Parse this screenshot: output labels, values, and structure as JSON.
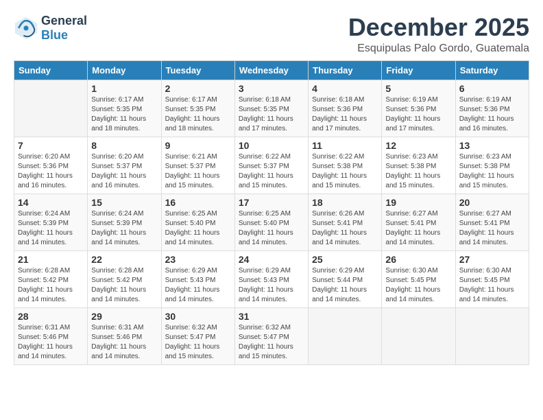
{
  "header": {
    "logo_general": "General",
    "logo_blue": "Blue",
    "month": "December 2025",
    "location": "Esquipulas Palo Gordo, Guatemala"
  },
  "weekdays": [
    "Sunday",
    "Monday",
    "Tuesday",
    "Wednesday",
    "Thursday",
    "Friday",
    "Saturday"
  ],
  "weeks": [
    [
      {
        "day": "",
        "sunrise": "",
        "sunset": "",
        "daylight": ""
      },
      {
        "day": "1",
        "sunrise": "Sunrise: 6:17 AM",
        "sunset": "Sunset: 5:35 PM",
        "daylight": "Daylight: 11 hours and 18 minutes."
      },
      {
        "day": "2",
        "sunrise": "Sunrise: 6:17 AM",
        "sunset": "Sunset: 5:35 PM",
        "daylight": "Daylight: 11 hours and 18 minutes."
      },
      {
        "day": "3",
        "sunrise": "Sunrise: 6:18 AM",
        "sunset": "Sunset: 5:35 PM",
        "daylight": "Daylight: 11 hours and 17 minutes."
      },
      {
        "day": "4",
        "sunrise": "Sunrise: 6:18 AM",
        "sunset": "Sunset: 5:36 PM",
        "daylight": "Daylight: 11 hours and 17 minutes."
      },
      {
        "day": "5",
        "sunrise": "Sunrise: 6:19 AM",
        "sunset": "Sunset: 5:36 PM",
        "daylight": "Daylight: 11 hours and 17 minutes."
      },
      {
        "day": "6",
        "sunrise": "Sunrise: 6:19 AM",
        "sunset": "Sunset: 5:36 PM",
        "daylight": "Daylight: 11 hours and 16 minutes."
      }
    ],
    [
      {
        "day": "7",
        "sunrise": "Sunrise: 6:20 AM",
        "sunset": "Sunset: 5:36 PM",
        "daylight": "Daylight: 11 hours and 16 minutes."
      },
      {
        "day": "8",
        "sunrise": "Sunrise: 6:20 AM",
        "sunset": "Sunset: 5:37 PM",
        "daylight": "Daylight: 11 hours and 16 minutes."
      },
      {
        "day": "9",
        "sunrise": "Sunrise: 6:21 AM",
        "sunset": "Sunset: 5:37 PM",
        "daylight": "Daylight: 11 hours and 15 minutes."
      },
      {
        "day": "10",
        "sunrise": "Sunrise: 6:22 AM",
        "sunset": "Sunset: 5:37 PM",
        "daylight": "Daylight: 11 hours and 15 minutes."
      },
      {
        "day": "11",
        "sunrise": "Sunrise: 6:22 AM",
        "sunset": "Sunset: 5:38 PM",
        "daylight": "Daylight: 11 hours and 15 minutes."
      },
      {
        "day": "12",
        "sunrise": "Sunrise: 6:23 AM",
        "sunset": "Sunset: 5:38 PM",
        "daylight": "Daylight: 11 hours and 15 minutes."
      },
      {
        "day": "13",
        "sunrise": "Sunrise: 6:23 AM",
        "sunset": "Sunset: 5:38 PM",
        "daylight": "Daylight: 11 hours and 15 minutes."
      }
    ],
    [
      {
        "day": "14",
        "sunrise": "Sunrise: 6:24 AM",
        "sunset": "Sunset: 5:39 PM",
        "daylight": "Daylight: 11 hours and 14 minutes."
      },
      {
        "day": "15",
        "sunrise": "Sunrise: 6:24 AM",
        "sunset": "Sunset: 5:39 PM",
        "daylight": "Daylight: 11 hours and 14 minutes."
      },
      {
        "day": "16",
        "sunrise": "Sunrise: 6:25 AM",
        "sunset": "Sunset: 5:40 PM",
        "daylight": "Daylight: 11 hours and 14 minutes."
      },
      {
        "day": "17",
        "sunrise": "Sunrise: 6:25 AM",
        "sunset": "Sunset: 5:40 PM",
        "daylight": "Daylight: 11 hours and 14 minutes."
      },
      {
        "day": "18",
        "sunrise": "Sunrise: 6:26 AM",
        "sunset": "Sunset: 5:41 PM",
        "daylight": "Daylight: 11 hours and 14 minutes."
      },
      {
        "day": "19",
        "sunrise": "Sunrise: 6:27 AM",
        "sunset": "Sunset: 5:41 PM",
        "daylight": "Daylight: 11 hours and 14 minutes."
      },
      {
        "day": "20",
        "sunrise": "Sunrise: 6:27 AM",
        "sunset": "Sunset: 5:41 PM",
        "daylight": "Daylight: 11 hours and 14 minutes."
      }
    ],
    [
      {
        "day": "21",
        "sunrise": "Sunrise: 6:28 AM",
        "sunset": "Sunset: 5:42 PM",
        "daylight": "Daylight: 11 hours and 14 minutes."
      },
      {
        "day": "22",
        "sunrise": "Sunrise: 6:28 AM",
        "sunset": "Sunset: 5:42 PM",
        "daylight": "Daylight: 11 hours and 14 minutes."
      },
      {
        "day": "23",
        "sunrise": "Sunrise: 6:29 AM",
        "sunset": "Sunset: 5:43 PM",
        "daylight": "Daylight: 11 hours and 14 minutes."
      },
      {
        "day": "24",
        "sunrise": "Sunrise: 6:29 AM",
        "sunset": "Sunset: 5:43 PM",
        "daylight": "Daylight: 11 hours and 14 minutes."
      },
      {
        "day": "25",
        "sunrise": "Sunrise: 6:29 AM",
        "sunset": "Sunset: 5:44 PM",
        "daylight": "Daylight: 11 hours and 14 minutes."
      },
      {
        "day": "26",
        "sunrise": "Sunrise: 6:30 AM",
        "sunset": "Sunset: 5:45 PM",
        "daylight": "Daylight: 11 hours and 14 minutes."
      },
      {
        "day": "27",
        "sunrise": "Sunrise: 6:30 AM",
        "sunset": "Sunset: 5:45 PM",
        "daylight": "Daylight: 11 hours and 14 minutes."
      }
    ],
    [
      {
        "day": "28",
        "sunrise": "Sunrise: 6:31 AM",
        "sunset": "Sunset: 5:46 PM",
        "daylight": "Daylight: 11 hours and 14 minutes."
      },
      {
        "day": "29",
        "sunrise": "Sunrise: 6:31 AM",
        "sunset": "Sunset: 5:46 PM",
        "daylight": "Daylight: 11 hours and 14 minutes."
      },
      {
        "day": "30",
        "sunrise": "Sunrise: 6:32 AM",
        "sunset": "Sunset: 5:47 PM",
        "daylight": "Daylight: 11 hours and 15 minutes."
      },
      {
        "day": "31",
        "sunrise": "Sunrise: 6:32 AM",
        "sunset": "Sunset: 5:47 PM",
        "daylight": "Daylight: 11 hours and 15 minutes."
      },
      {
        "day": "",
        "sunrise": "",
        "sunset": "",
        "daylight": ""
      },
      {
        "day": "",
        "sunrise": "",
        "sunset": "",
        "daylight": ""
      },
      {
        "day": "",
        "sunrise": "",
        "sunset": "",
        "daylight": ""
      }
    ]
  ]
}
